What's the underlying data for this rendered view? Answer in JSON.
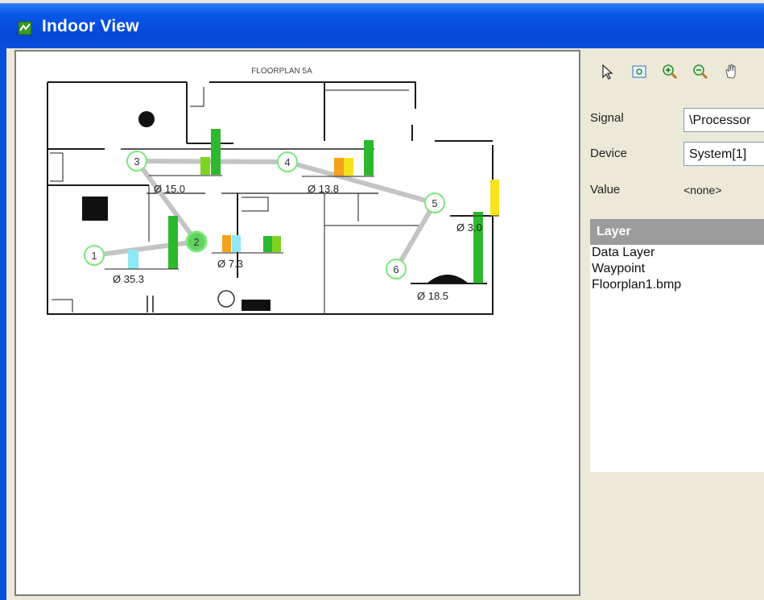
{
  "window": {
    "title": "Indoor View"
  },
  "floorplan": {
    "title": "FLOORPLAN 5A",
    "waypoints": [
      {
        "id": "1",
        "label": "1"
      },
      {
        "id": "2",
        "label": "2"
      },
      {
        "id": "3",
        "label": "3"
      },
      {
        "id": "4",
        "label": "4"
      },
      {
        "id": "5",
        "label": "5"
      },
      {
        "id": "6",
        "label": "6"
      }
    ],
    "readings": [
      {
        "id": "r1",
        "text": "Ø 35.3"
      },
      {
        "id": "r2",
        "text": "Ø 7.3"
      },
      {
        "id": "r3",
        "text": "Ø 15.0"
      },
      {
        "id": "r4",
        "text": "Ø 13.8"
      },
      {
        "id": "r5",
        "text": "Ø 3.0"
      },
      {
        "id": "r6",
        "text": "Ø 18.5"
      }
    ],
    "colors": {
      "green": "#2db82d",
      "light_green": "#7ed321",
      "cyan": "#8ee8f4",
      "orange": "#f4a21a",
      "yellow": "#f5e31c",
      "path": "#c4c4c4",
      "wall": "#1a1a1a"
    }
  },
  "toolbar": {
    "tools": [
      {
        "name": "select-tool-icon"
      },
      {
        "name": "zoom-fit-icon"
      },
      {
        "name": "zoom-in-icon"
      },
      {
        "name": "zoom-out-icon"
      },
      {
        "name": "pan-hand-icon"
      }
    ]
  },
  "properties": {
    "signal_label": "Signal",
    "signal_value": "\\Processor",
    "device_label": "Device",
    "device_value": "System[1]",
    "value_label": "Value",
    "value_value": "<none>"
  },
  "layers": {
    "header": "Layer",
    "items": [
      "Data Layer",
      "Waypoint",
      "Floorplan1.bmp"
    ]
  }
}
